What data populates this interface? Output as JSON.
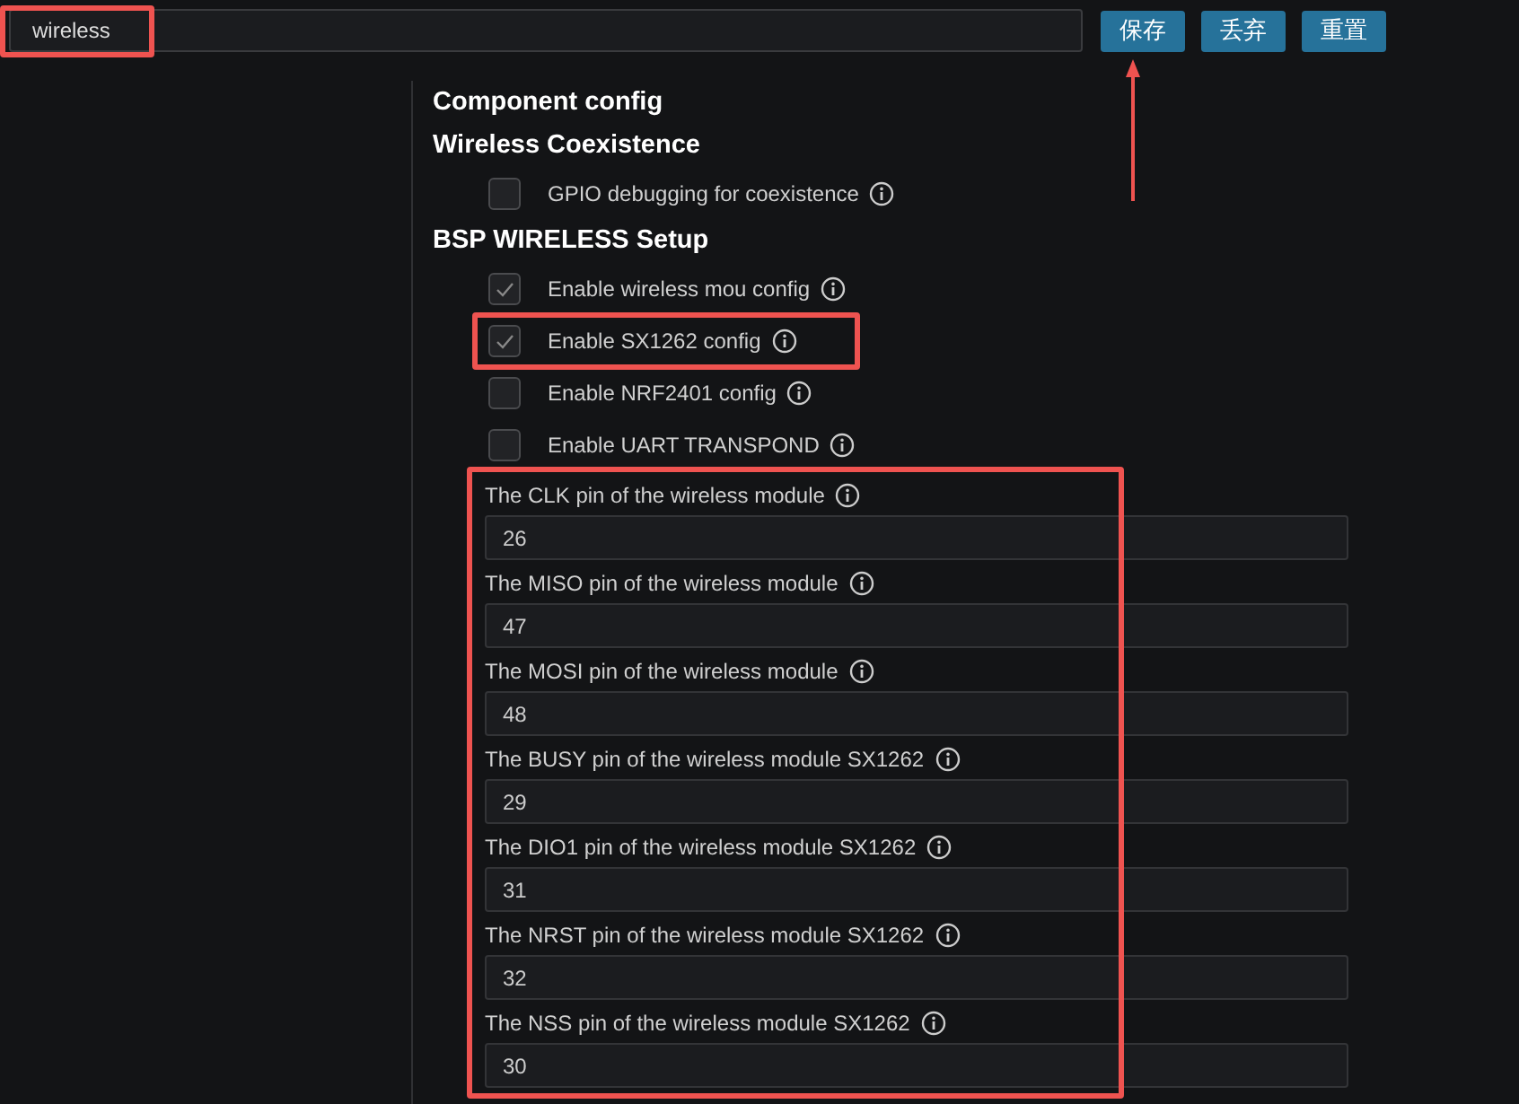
{
  "search": {
    "value": "wireless",
    "highlighted": true
  },
  "buttons": [
    {
      "label": "保存",
      "arrow_pointer": true
    },
    {
      "label": "丢弃",
      "arrow_pointer": false
    },
    {
      "label": "重置",
      "arrow_pointer": false
    }
  ],
  "sections": [
    {
      "title": "Component config"
    },
    {
      "title": "Wireless Coexistence",
      "items": [
        {
          "kind": "checkbox",
          "label": "GPIO debugging for coexistence",
          "checked": false,
          "highlighted": false
        }
      ]
    },
    {
      "title": "BSP WIRELESS Setup",
      "items": [
        {
          "kind": "checkbox",
          "label": "Enable wireless mou config",
          "checked": true,
          "highlighted": false
        },
        {
          "kind": "checkbox",
          "label": "Enable SX1262 config",
          "checked": true,
          "highlighted": true
        },
        {
          "kind": "checkbox",
          "label": "Enable NRF2401 config",
          "checked": false,
          "highlighted": false
        },
        {
          "kind": "checkbox",
          "label": "Enable UART TRANSPOND",
          "checked": false,
          "highlighted": false
        }
      ],
      "fields_highlighted": true,
      "fields": [
        {
          "label": "The CLK pin of the wireless module",
          "value": "26"
        },
        {
          "label": "The MISO pin of the wireless module",
          "value": "47"
        },
        {
          "label": "The MOSI pin of the wireless module",
          "value": "48"
        },
        {
          "label": "The BUSY pin of the wireless module SX1262",
          "value": "29"
        },
        {
          "label": "The DIO1 pin of the wireless module SX1262",
          "value": "31"
        },
        {
          "label": "The NRST pin of the wireless module SX1262",
          "value": "32"
        },
        {
          "label": "The NSS pin of the wireless module SX1262",
          "value": "30"
        }
      ]
    }
  ]
}
